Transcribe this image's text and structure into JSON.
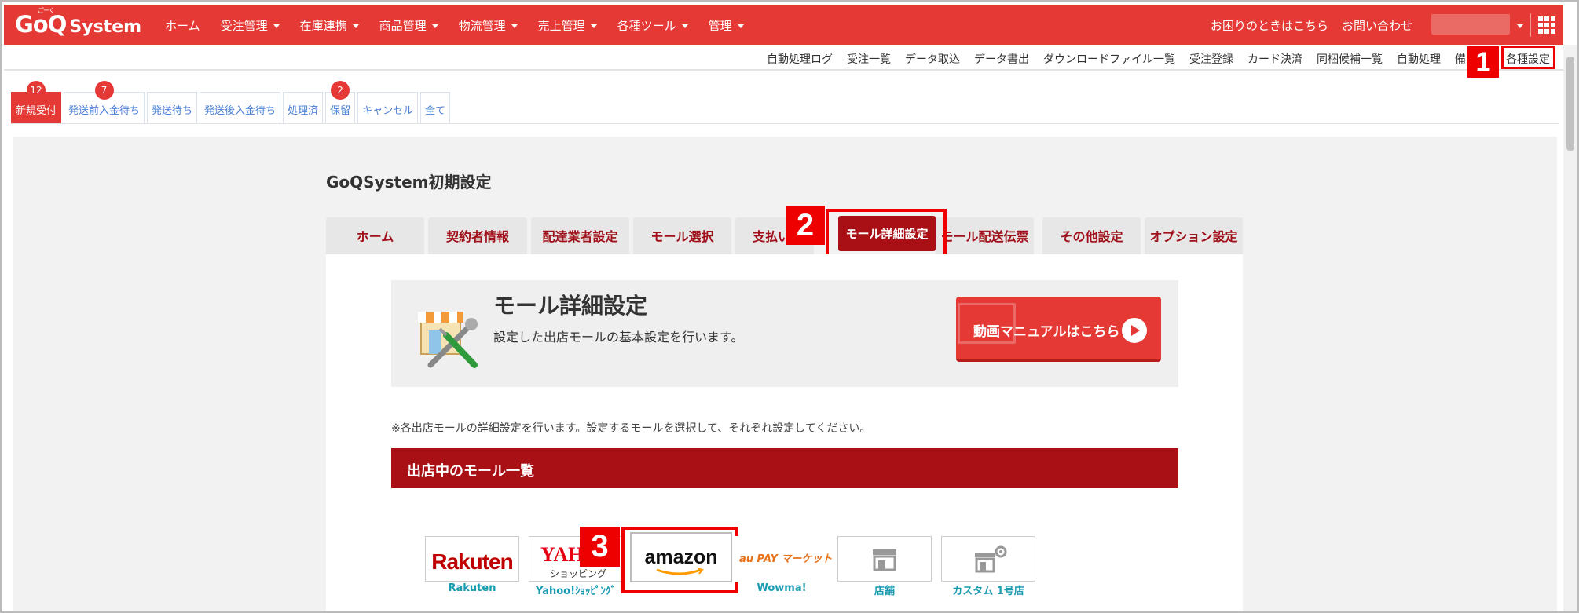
{
  "app": {
    "logo_text": "GoQ",
    "logo_ruby": "ごーく",
    "logo_suffix": "System"
  },
  "topnav": {
    "items": [
      "ホーム",
      "受注管理",
      "在庫連携",
      "商品管理",
      "物流管理",
      "売上管理",
      "各種ツール",
      "管理"
    ],
    "help": "お困りのときはこちら",
    "contact": "お問い合わせ"
  },
  "subnav": {
    "links": [
      "自動処理ログ",
      "受注一覧",
      "データ取込",
      "データ書出",
      "ダウンロードファイル一覧",
      "受注登録",
      "カード決済",
      "同梱候補一覧",
      "自動処理",
      "備考欄"
    ],
    "highlighted": "各種設定"
  },
  "status_tabs": [
    {
      "label": "新規受付",
      "badge": "12"
    },
    {
      "label": "発送前入金待ち",
      "badge": "7"
    },
    {
      "label": "発送待ち",
      "badge": ""
    },
    {
      "label": "発送後入金待ち",
      "badge": ""
    },
    {
      "label": "処理済",
      "badge": ""
    },
    {
      "label": "保留",
      "badge": "2"
    },
    {
      "label": "キャンセル",
      "badge": ""
    },
    {
      "label": "全て",
      "badge": ""
    }
  ],
  "page": {
    "title": "GoQSystem初期設定"
  },
  "settings_tabs": [
    "ホーム",
    "契約者情報",
    "配達業者設定",
    "モール選択",
    "支払い",
    "モール詳細設定",
    "モール配送伝票",
    "その他設定",
    "オプション設定"
  ],
  "hero": {
    "title": "モール詳細設定",
    "subtitle": "設定した出店モールの基本設定を行います。",
    "video_button": "動画マニュアルはこちら"
  },
  "note": "※各出店モールの詳細設定を行います。設定するモールを選択して、それぞれ設定してください。",
  "mall_section_title": "出店中のモール一覧",
  "malls": [
    {
      "logo": "Rakuten",
      "name": "Rakuten"
    },
    {
      "logo": "YAH",
      "logo_sub": "ショッピング",
      "name": "Yahoo!ｼｮｯﾋﾟﾝｸﾞ"
    },
    {
      "logo": "amazon",
      "name": ""
    },
    {
      "logo": "au PAY マーケット",
      "name": "Wowma!"
    },
    {
      "logo": "",
      "name": "店舗"
    },
    {
      "logo": "",
      "name": "カスタム 1号店"
    }
  ],
  "callouts": [
    "1",
    "2",
    "3"
  ],
  "colors": {
    "brand_red": "#e53935",
    "dark_red": "#a81015",
    "highlight": "#ee0000",
    "link_blue": "#4a7fd6",
    "teal": "#1a9bb0"
  }
}
